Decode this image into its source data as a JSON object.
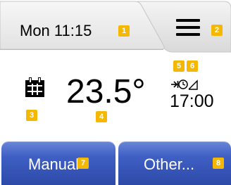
{
  "header": {
    "datetime": "Mon 11:15",
    "menu_icon": "hamburger-menu-icon"
  },
  "main": {
    "schedule_icon": "calendar-icon",
    "temperature": "23.5°",
    "mode_icon": "arrow-clock-ramp-icon",
    "next_event_time": "17:00"
  },
  "buttons": {
    "manual_label": "Manual",
    "other_label": "Other..."
  },
  "badges": [
    "1",
    "2",
    "3",
    "4",
    "5",
    "6",
    "7",
    "8"
  ],
  "colors": {
    "header_tab": "#ebebeb",
    "badge": "#f5b800",
    "button_blue": "#3f5fc4"
  }
}
